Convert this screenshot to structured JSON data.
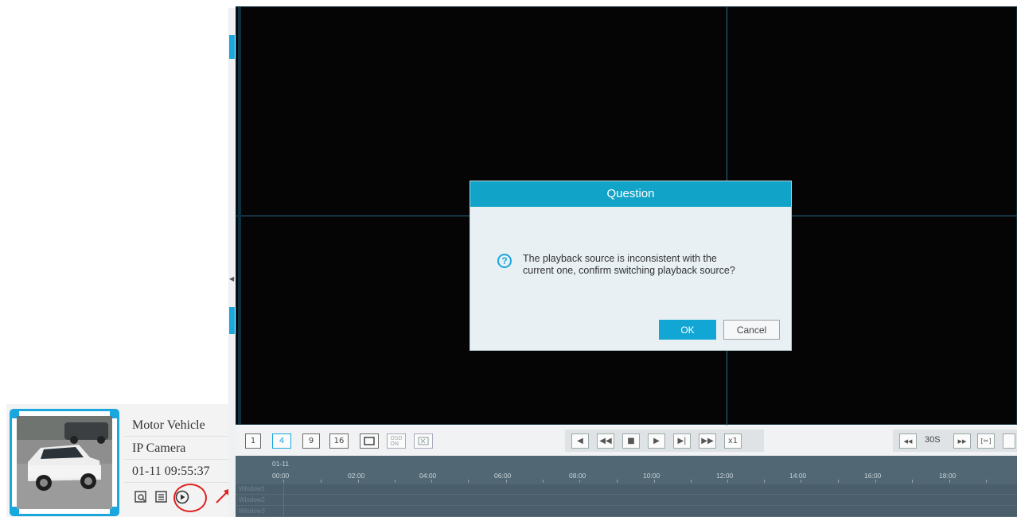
{
  "event_card": {
    "info": [
      "Motor Vehicle",
      "IP Camera",
      "01-11 09:55:37"
    ],
    "actions": [
      "search-icon",
      "list-icon",
      "play-icon"
    ]
  },
  "dialog": {
    "title": "Question",
    "message_line1": "The playback source is inconsistent with the",
    "message_line2": "current one, confirm switching playback source?",
    "ok_label": "OK",
    "cancel_label": "Cancel"
  },
  "toolbar": {
    "layouts": [
      "1",
      "4",
      "9",
      "16"
    ],
    "active_layout": "4",
    "speed": "x1",
    "interval": "30S"
  },
  "timeline": {
    "date": "01-11",
    "hours": [
      "00:00",
      "02:00",
      "04:00",
      "06:00",
      "08:00",
      "10:00",
      "12:00",
      "14:00",
      "16:00",
      "18:00"
    ],
    "row_labels": [
      "Window1",
      "Window2",
      "Window3"
    ]
  },
  "colors": {
    "accent": "#12a3c8",
    "highlight": "#e02020"
  }
}
